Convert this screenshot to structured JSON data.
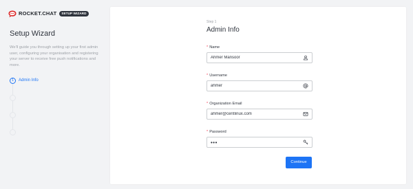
{
  "brand": {
    "name": "ROCKET.CHAT",
    "badge": "SETUP WIZARD"
  },
  "sidebar": {
    "title": "Setup Wizard",
    "description": "We'll guide you through setting up your first admin user, configuring your organisation and registering your server to receive free push notifications and more.",
    "steps": [
      {
        "number": "1",
        "label": "Admin Info",
        "active": true
      },
      {
        "number": "",
        "label": "",
        "active": false
      },
      {
        "number": "",
        "label": "",
        "active": false
      },
      {
        "number": "",
        "label": "",
        "active": false
      }
    ]
  },
  "form": {
    "step_caption": "Step 1",
    "title": "Admin Info",
    "required_mark": "*",
    "fields": [
      {
        "label": "Name",
        "value": "Ahmer Mansoor",
        "icon": "user-icon"
      },
      {
        "label": "Username",
        "value": "ahmer",
        "icon": "at-sign-icon"
      },
      {
        "label": "Organization Email",
        "value": "ahmer@centlinux.com",
        "icon": "envelope-icon"
      },
      {
        "label": "Password",
        "value": "•••",
        "icon": "key-icon"
      }
    ],
    "continue_label": "Continue"
  },
  "colors": {
    "accent": "#1d74f5",
    "required": "#f5455c",
    "brand_red": "#db2323",
    "page_bg": "#f2f3f5",
    "card_bg": "#ffffff"
  }
}
